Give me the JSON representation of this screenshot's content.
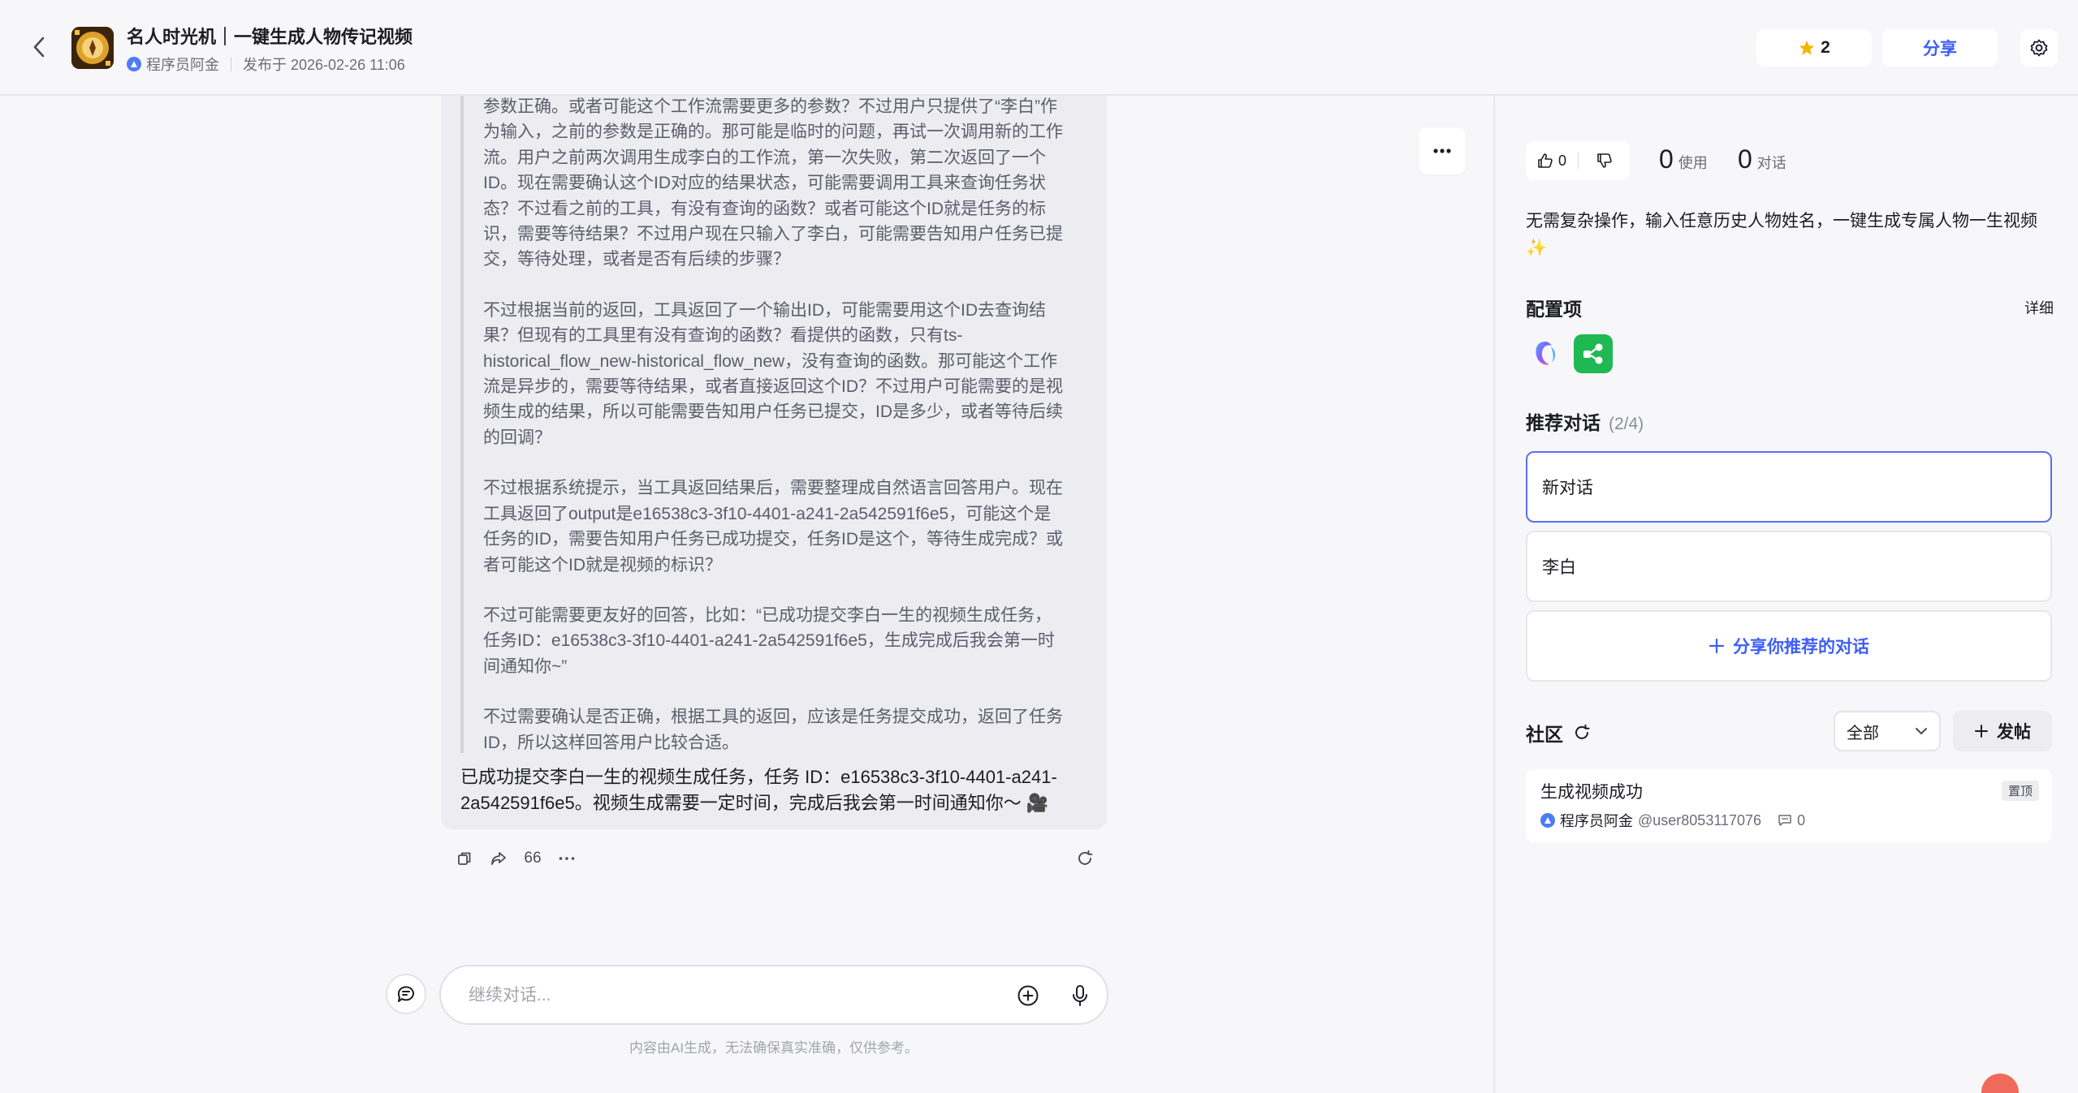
{
  "header": {
    "title": "名人时光机｜一键生成人物传记视频",
    "author": "程序员阿金",
    "published": "发布于 2026-02-26 11:06",
    "star_count": "2",
    "share_label": "分享"
  },
  "chat": {
    "reasoning": [
      "参数正确。或者可能这个工作流需要更多的参数？不过用户只提供了“李白”作为输入，之前的参数是正确的。那可能是临时的问题，再试一次调用新的工作流。用户之前两次调用生成李白的工作流，第一次失败，第二次返回了一个ID。现在需要确认这个ID对应的结果状态，可能需要调用工具来查询任务状态？不过看之前的工具，有没有查询的函数？或者可能这个ID就是任务的标识，需要等待结果？不过用户现在只输入了李白，可能需要告知用户任务已提交，等待处理，或者是否有后续的步骤？",
      "不过根据当前的返回，工具返回了一个输出ID，可能需要用这个ID去查询结果？但现有的工具里有没有查询的函数？看提供的函数，只有ts-historical_flow_new-historical_flow_new，没有查询的函数。那可能这个工作流是异步的，需要等待结果，或者直接返回这个ID？不过用户可能需要的是视频生成的结果，所以可能需要告知用户任务已提交，ID是多少，或者等待后续的回调？",
      "不过根据系统提示，当工具返回结果后，需要整理成自然语言回答用户。现在工具返回了output是e16538c3-3f10-4401-a241-2a542591f6e5，可能这个是任务的ID，需要告知用户任务已成功提交，任务ID是这个，等待生成完成？或者可能这个ID就是视频的标识？",
      "不过可能需要更友好的回答，比如：“已成功提交李白一生的视频生成任务，任务ID：e16538c3-3f10-4401-a241-2a542591f6e5，生成完成后我会第一时间通知你~”",
      "不过需要确认是否正确，根据工具的返回，应该是任务提交成功，返回了任务ID，所以这样回答用户比较合适。"
    ],
    "answer": "已成功提交李白一生的视频生成任务，任务 ID：e16538c3-3f10-4401-a241-2a542591f6e5。视频生成需要一定时间，完成后我会第一时间通知你～ 🎥",
    "quote_label": "66",
    "input_placeholder": "继续对话...",
    "disclaimer": "内容由AI生成，无法确保真实准确，仅供参考。"
  },
  "panel": {
    "like_count": "0",
    "usage_num": "0",
    "usage_label": "使用",
    "dialog_num": "0",
    "dialog_label": "对话",
    "description": "无需复杂操作，输入任意历史人物姓名，一键生成专属人物一生视频 ✨",
    "config_title": "配置项",
    "detail_label": "详细",
    "recommend_title": "推荐对话",
    "recommend_count": "(2/4)",
    "recommend_items": [
      "新对话",
      "李白"
    ],
    "recommend_add": "分享你推荐的对话",
    "community_title": "社区",
    "filter_value": "全部",
    "post_label": "发帖",
    "post": {
      "title": "生成视频成功",
      "author": "程序员阿金",
      "user": "@user8053117076",
      "comments": "0",
      "pin": "置顶"
    }
  },
  "colors": {
    "accent": "#3d5ef6",
    "active_border": "#5b6ef0",
    "plugin_green": "#1fb954"
  }
}
